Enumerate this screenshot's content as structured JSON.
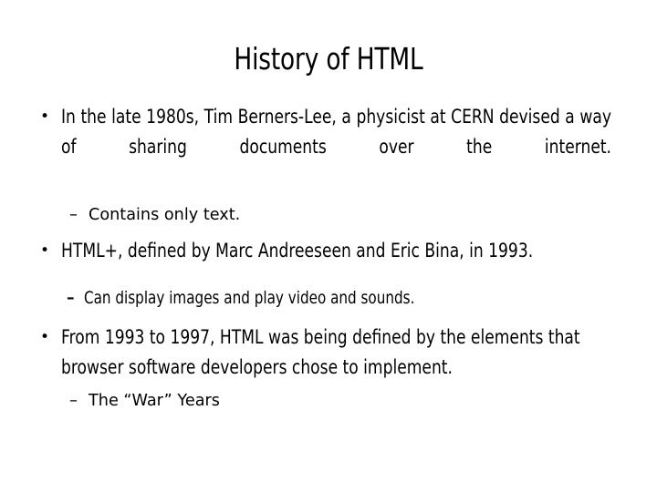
{
  "slide": {
    "title": "History of HTML",
    "bullets": [
      {
        "level": 1,
        "marker": "•",
        "text": "In the late 1980s, Tim Berners-Lee, a physicist at CERN devised a way of sharing documents over the internet."
      },
      {
        "level": 2,
        "marker": "–",
        "text": "Contains only text."
      },
      {
        "level": 1,
        "marker": "•",
        "text": "HTML+, defined by Marc Andreeseen and Eric Bina, in 1993."
      },
      {
        "level": 2,
        "marker": "–",
        "text": "Can display images and play video and sounds."
      },
      {
        "level": 1,
        "marker": "•",
        "text": "From 1993 to 1997, HTML was being defined by the elements that browser software developers chose to implement."
      },
      {
        "level": 2,
        "marker": "–",
        "text": "The “War” Years"
      }
    ]
  },
  "colors": {
    "background": "#ffffff",
    "text": "#000000"
  }
}
